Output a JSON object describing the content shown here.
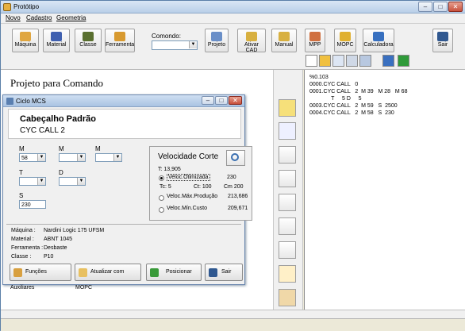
{
  "window": {
    "title": "Protótipo",
    "min": "–",
    "max": "□",
    "close": "✕"
  },
  "menu": [
    "Novo",
    "Cadastro",
    "Geometria"
  ],
  "toolbar": {
    "buttons": [
      {
        "label": "Máquina",
        "icon": "machine-icon",
        "color": "#e0a640"
      },
      {
        "label": "Material",
        "icon": "material-icon",
        "color": "#4060b0"
      },
      {
        "label": "Classe",
        "icon": "class-icon",
        "color": "#5a7030"
      },
      {
        "label": "Ferramenta",
        "icon": "tool-icon",
        "color": "#d89a30"
      },
      {
        "label": "Projeto",
        "icon": "document-icon",
        "color": "#6a8fc8"
      },
      {
        "label": "Ativar CAD",
        "icon": "ruler-icon",
        "color": "#d8b040"
      },
      {
        "label": "Manual",
        "icon": "ruler-icon",
        "color": "#d8b040"
      },
      {
        "label": "MPP",
        "icon": "chart-icon",
        "color": "#d07040"
      },
      {
        "label": "MOPC",
        "icon": "coins-icon",
        "color": "#e0b030"
      },
      {
        "label": "Calculadora",
        "icon": "calculator-icon",
        "color": "#3870c0"
      },
      {
        "label": "Sair",
        "icon": "exit-door-icon",
        "color": "#305890"
      }
    ],
    "command_label": "Comondo:",
    "command_value": "",
    "small_buttons": [
      "new-file-icon",
      "open-folder-icon",
      "copy-icon",
      "cut-icon",
      "paste-icon",
      "refresh-icon",
      "save-icon"
    ]
  },
  "project_title": "Projeto para Comando",
  "right_tools": [
    "nc-icon",
    "mog-icon",
    "curve-icon",
    "step-icon",
    "axis-icon",
    "bars-icon",
    "path-icon",
    "pair-icon",
    "clipboard-icon"
  ],
  "code_lines": [
    "%0.103",
    "0000.CYC CALL   0",
    "0001.CYC CALL   2  M 39   M 28   M 68",
    "              T     5 D     5",
    "0003.CYC CALL   2  M 59   S  2500",
    "0004.CYC CALL   2  M 58   S  230"
  ],
  "dialog": {
    "title": "Ciclo MCS",
    "heading": "Cabeçalho Padrão",
    "subheading": "CYC CALL 2",
    "m_labels": [
      "M",
      "M",
      "M"
    ],
    "m1_value": "58",
    "t_label": "T",
    "d_label": "D",
    "s_label": "S",
    "s_value": "230",
    "velocity": {
      "title": "Velocidade Corte",
      "t_text": "T: 13,905",
      "otimizada_label": "Veloc.Otimizada",
      "otimizada_value": "230",
      "tc_text": "Tc: 5",
      "ct_text": "Ct: 100",
      "cm_text": "Cm 200",
      "maxprod_label": "Veloc.Máx.Produção",
      "maxprod_value": "213,686",
      "mincusto_label": "Veloc.Mín.Custo",
      "mincusto_value": "209,671"
    },
    "info": {
      "maquina_label": "Máquina :",
      "maquina_value": "Nardini Logic 175 UFSM",
      "material_label": "Material :",
      "material_value": "ABNT 1045",
      "ferramenta_label": "Ferramenta :",
      "ferramenta_value": "Desbaste",
      "classe_label": "Classe :",
      "classe_value": "P10"
    },
    "buttons": {
      "funcoes": "Funções Auxiliares",
      "atualizar": "Atualizar com MOPC",
      "posicionar": "Posicionar",
      "sair": "Sair"
    }
  }
}
